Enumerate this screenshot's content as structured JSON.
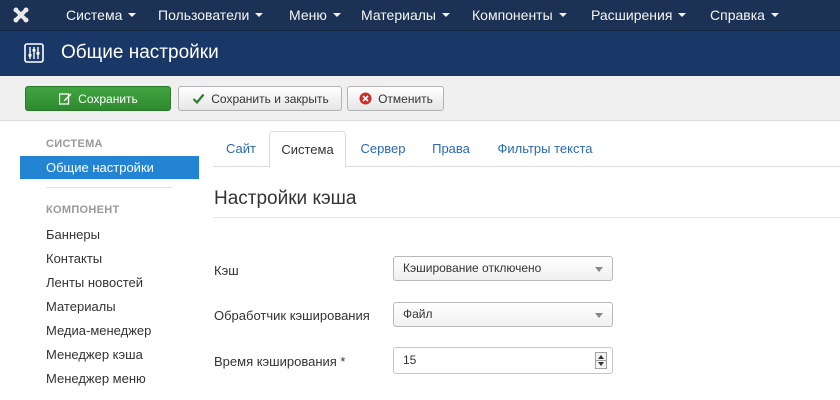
{
  "navbar": {
    "items": [
      {
        "label": "Система"
      },
      {
        "label": "Пользователи"
      },
      {
        "label": "Меню"
      },
      {
        "label": "Материалы"
      },
      {
        "label": "Компоненты"
      },
      {
        "label": "Расширения"
      },
      {
        "label": "Справка"
      }
    ],
    "background": "#1b3254"
  },
  "titlebar": {
    "title": "Общие настройки",
    "background": "#1a3867"
  },
  "toolbar": {
    "save_label": "Сохранить",
    "save_close_label": "Сохранить и закрыть",
    "cancel_label": "Отменить",
    "save_color": "#3a9a3a",
    "cancel_icon_color": "#c9302c"
  },
  "sidebar": {
    "system_header": "СИСТЕМА",
    "system_items": [
      {
        "label": "Общие настройки",
        "active": true
      }
    ],
    "component_header": "КОМПОНЕНТ",
    "component_items": [
      {
        "label": "Баннеры"
      },
      {
        "label": "Контакты"
      },
      {
        "label": "Ленты новостей"
      },
      {
        "label": "Материалы"
      },
      {
        "label": "Медиа-менеджер"
      },
      {
        "label": "Менеджер кэша"
      },
      {
        "label": "Менеджер меню"
      }
    ],
    "active_color": "#2384d3"
  },
  "tabs": [
    {
      "label": "Сайт",
      "active": false
    },
    {
      "label": "Система",
      "active": true
    },
    {
      "label": "Сервер",
      "active": false
    },
    {
      "label": "Права",
      "active": false
    },
    {
      "label": "Фильтры текста",
      "active": false
    }
  ],
  "main": {
    "section_title": "Настройки кэша",
    "fields": [
      {
        "label": "Кэш",
        "value": "Кэширование отключено",
        "kind": "select"
      },
      {
        "label": "Обработчик кэширования",
        "value": "Файл",
        "kind": "select"
      },
      {
        "label": "Время кэширования *",
        "value": "15",
        "kind": "number"
      }
    ]
  }
}
